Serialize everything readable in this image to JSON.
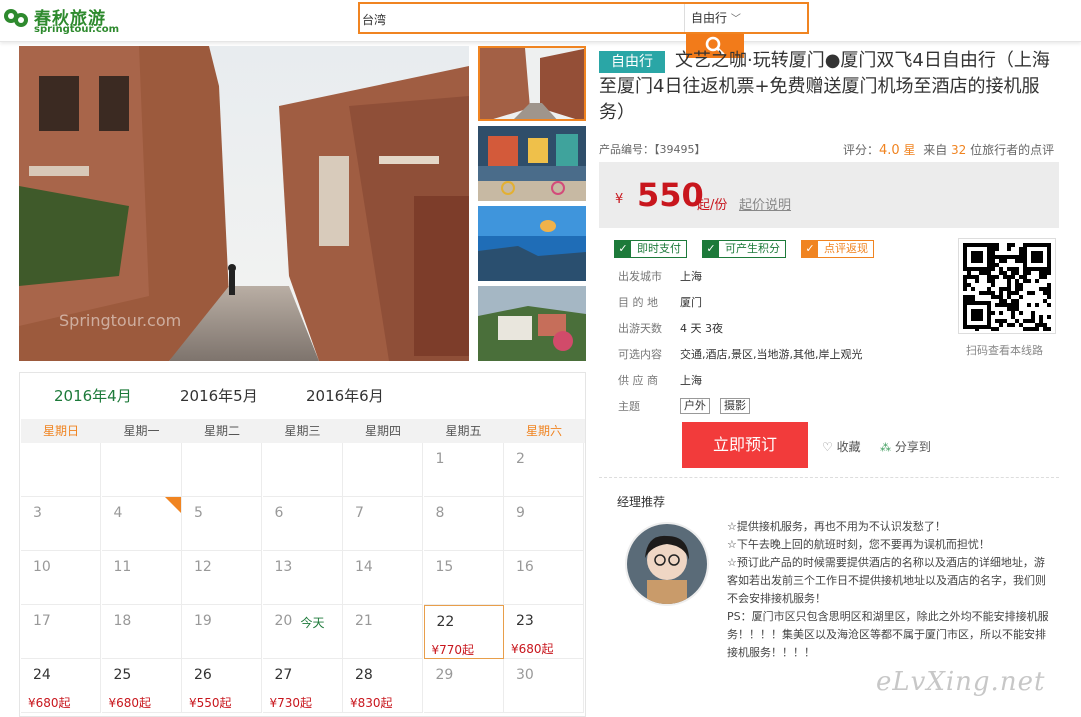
{
  "header": {
    "logo_name": "春秋旅游",
    "logo_domain": "springtour.com",
    "search_value": "台湾",
    "search_type": "自由行"
  },
  "product": {
    "tag": "自由行",
    "title": "文艺之咖·玩转厦门●厦门双飞4日自由行（上海至厦门4日往返机票+免费赠送厦门机场至酒店的接机服务）",
    "id_label": "产品编号：【39495】",
    "rating_label": "评分：",
    "rating_value": "4.0",
    "rating_unit": "星",
    "reviews_prefix": "来自",
    "reviews_count": "32",
    "reviews_suffix": "位旅行者的点评",
    "currency": "¥",
    "price": "550",
    "price_unit": "起/份",
    "price_note": "起价说明",
    "features": [
      "即时支付",
      "可产生积分",
      "点评返现"
    ],
    "details": [
      {
        "label": "出发城市",
        "value": "上海"
      },
      {
        "label": "目 的 地",
        "value": "厦门"
      },
      {
        "label": "出游天数",
        "value": "4 天 3夜"
      },
      {
        "label": "可选内容",
        "value": "交通,酒店,景区,当地游,其他,岸上观光"
      },
      {
        "label": "供 应 商",
        "value": "上海"
      },
      {
        "label": "主题",
        "value": ""
      }
    ],
    "themes": [
      "户外",
      "摄影"
    ],
    "qr_label": "扫码查看本线路",
    "book_label": "立即预订",
    "favorite_label": "收藏",
    "share_label": "分享到"
  },
  "manager": {
    "title": "经理推荐",
    "lines": [
      "☆提供接机服务，再也不用为不认识发愁了！",
      "☆下午去晚上回的航班时刻，您不要再为误机而担忧！",
      "☆预订此产品的时候需要提供酒店的名称以及酒店的详细地址，游客如若出发前三个工作日不提供接机地址以及酒店的名字，我们则不会安排接机服务！",
      "PS：厦门市区只包含思明区和湖里区，除此之外均不能安排接机服务！！！！集美区以及海沧区等都不属于厦门市区，所以不能安排接机服务！！！！"
    ]
  },
  "calendar": {
    "months": [
      "2016年4月",
      "2016年5月",
      "2016年6月"
    ],
    "weekdays": [
      "星期日",
      "星期一",
      "星期二",
      "星期三",
      "星期四",
      "星期五",
      "星期六"
    ],
    "today_label": "今天",
    "weeks": [
      [
        {
          "d": ""
        },
        {
          "d": ""
        },
        {
          "d": ""
        },
        {
          "d": ""
        },
        {
          "d": ""
        },
        {
          "d": "1"
        },
        {
          "d": "2"
        }
      ],
      [
        {
          "d": "3"
        },
        {
          "d": "4",
          "flag": true
        },
        {
          "d": "5"
        },
        {
          "d": "6"
        },
        {
          "d": "7"
        },
        {
          "d": "8"
        },
        {
          "d": "9"
        }
      ],
      [
        {
          "d": "10"
        },
        {
          "d": "11"
        },
        {
          "d": "12"
        },
        {
          "d": "13"
        },
        {
          "d": "14"
        },
        {
          "d": "15"
        },
        {
          "d": "16"
        }
      ],
      [
        {
          "d": "17"
        },
        {
          "d": "18"
        },
        {
          "d": "19"
        },
        {
          "d": "20",
          "today": true
        },
        {
          "d": "21"
        },
        {
          "d": "22",
          "p": "¥770起",
          "sel": true
        },
        {
          "d": "23",
          "p": "¥680起"
        }
      ],
      [
        {
          "d": "24",
          "p": "¥680起"
        },
        {
          "d": "25",
          "p": "¥680起"
        },
        {
          "d": "26",
          "p": "¥550起"
        },
        {
          "d": "27",
          "p": "¥730起"
        },
        {
          "d": "28",
          "p": "¥830起"
        },
        {
          "d": "29"
        },
        {
          "d": "30"
        }
      ]
    ]
  },
  "watermark": "eLvXing.net",
  "colors": {
    "brand_green": "#1d7a3a",
    "orange": "#f08421",
    "price_red": "#c8161d",
    "book_red": "#f23b3b",
    "teal": "#2aa6a6"
  }
}
